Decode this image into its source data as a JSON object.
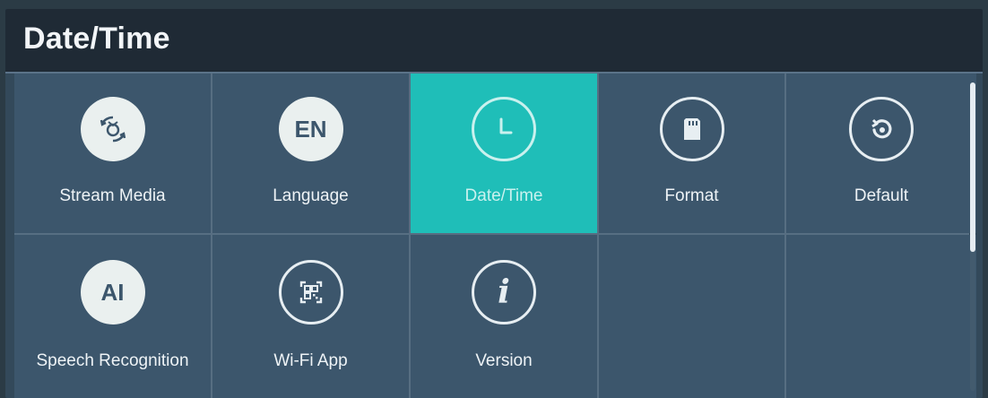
{
  "header": {
    "title": "Date/Time"
  },
  "menu": {
    "items": [
      {
        "label": "Stream Media",
        "icon": "stream-media-icon",
        "selected": false
      },
      {
        "label": "Language",
        "icon_text": "EN",
        "icon": "language-icon",
        "selected": false
      },
      {
        "label": "Date/Time",
        "icon": "clock-icon",
        "selected": true
      },
      {
        "label": "Format",
        "icon": "sd-card-icon",
        "selected": false
      },
      {
        "label": "Default",
        "icon": "reset-icon",
        "selected": false
      },
      {
        "label": "Speech Recognition",
        "icon_text": "AI",
        "icon": "ai-icon",
        "selected": false
      },
      {
        "label": "Wi-Fi App",
        "icon": "qr-code-icon",
        "selected": false
      },
      {
        "label": "Version",
        "icon_text": "i",
        "icon": "info-icon",
        "selected": false
      }
    ]
  },
  "colors": {
    "background": "#33495a",
    "titlebar": "#1f2a35",
    "tile": "#3c566c",
    "selected_tile": "#1fbeb8",
    "grid_line": "#576e82"
  },
  "scrollbar": {
    "position_fraction": 0.0,
    "visible_fraction": 0.55
  }
}
